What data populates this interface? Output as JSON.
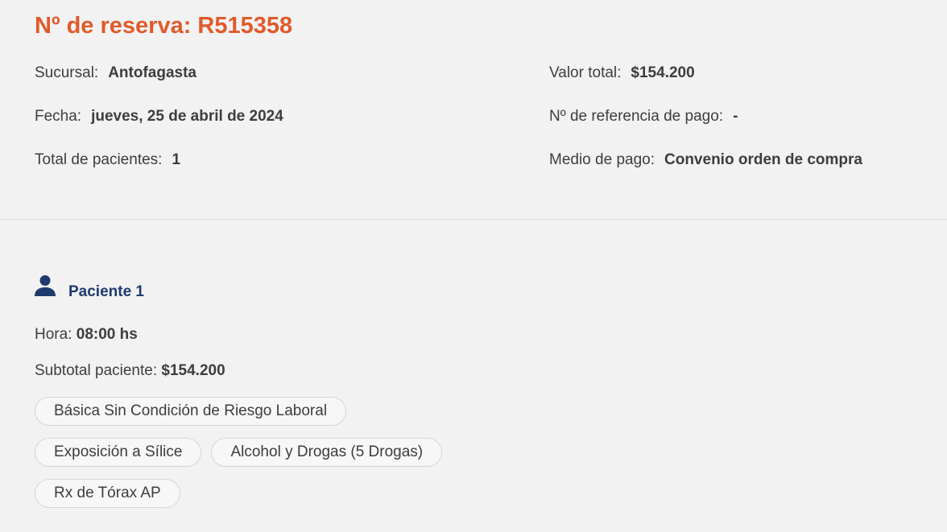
{
  "reservation": {
    "title": "Nº de reserva: R515358"
  },
  "details_left": {
    "sucursal_label": "Sucursal:",
    "sucursal_value": "Antofagasta",
    "fecha_label": "Fecha:",
    "fecha_value": "jueves, 25 de abril de 2024",
    "pacientes_label": "Total de pacientes:",
    "pacientes_value": "1"
  },
  "details_right": {
    "valor_label": "Valor total:",
    "valor_value": "$154.200",
    "referencia_label": "Nº de referencia de pago:",
    "referencia_value": "-",
    "medio_label": "Medio de pago:",
    "medio_value": "Convenio orden de compra"
  },
  "patient": {
    "icon": "person-icon",
    "name": "Paciente 1",
    "hora_label": "Hora:",
    "hora_value": "08:00 hs",
    "subtotal_label": "Subtotal paciente:",
    "subtotal_value": "$154.200",
    "exams": [
      "Básica Sin Condición de Riesgo Laboral",
      "Exposición a Sílice",
      "Alcohol y Drogas (5 Drogas)",
      "Rx de Tórax AP"
    ]
  },
  "colors": {
    "accent": "#e05a2b",
    "patient_name": "#1f3a6e",
    "background": "#f2f2f2"
  }
}
